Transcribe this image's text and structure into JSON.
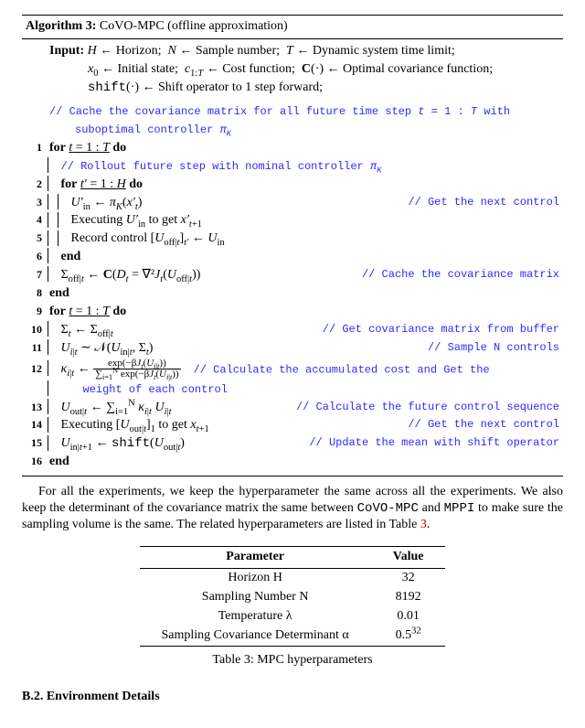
{
  "algo": {
    "heading": "Algorithm 3:",
    "name": "CoVO-MPC (offline approximation)",
    "input_label": "Input:",
    "input_l1": "H ← Horizon;  N ← Sample number;  T ← Dynamic system time limit;",
    "input_l2": "x₀ ← Initial state;  c₁:T ← Cost function;  C(·) ← Optimal covariance function;",
    "input_l3": "shift(·) ← Shift operator to 1 step forward;",
    "c_cache_a": "// Cache the covariance matrix for all future time step t = 1 : T with",
    "c_cache_b": "suboptimal controller πK",
    "for1": "for",
    "for1_cond": "t = 1 : T",
    "do": "do",
    "c_rollout": "// Rollout future step with nominal controller πK",
    "for2_cond": "t′ = 1 : H",
    "l3": "U′_in ← π_K(x′_t)",
    "c3": "// Get the next control",
    "l4": "Executing U′_in to get x′_{t+1}",
    "l5": "Record control [U_off|t]_{t′} ← U_in",
    "end": "end",
    "l7": "Σ_off|t ← C(D_t = ∇²J_t(U_off|t))",
    "c7": "// Cache the covariance matrix",
    "for3_cond": "t = 1 : T",
    "l10": "Σ_t ← Σ_off|t",
    "c10": "// Get covariance matrix from buffer",
    "l11": "U_{i|t} ∼ 𝓝(U_{in|t}, Σ_t)",
    "c11": "// Sample N controls",
    "l12a": "κ_{i|t} ← ",
    "frac_top": "exp(−βJ_t(U_{i|t}))",
    "frac_bot": "∑_{i=1}^{N} exp(−βJ_t(U_{i|t}))",
    "c12a": "// Calculate the accumulated cost and Get the",
    "c12b": "weight of each control",
    "l13": "U_{out|t} ← ∑_{i=1}^{N} κ_{i|t} U_{i|t}",
    "c13": "// Calculate the future control sequence",
    "l14": "Executing [U_{out|t}]₁ to get x_{t+1}",
    "c14": "// Get the next control",
    "l15": "U_{in|t+1} ← shift(U_{out|t})",
    "c15": "// Update the mean with shift operator"
  },
  "para1a": "For all the experiments, we keep the hyperparameter the same across all the experiments. We also keep the determinant of the covariance matrix the same between ",
  "para1b": " and ",
  "para1c": " to make sure the sampling volume is the same. The related hyperparameters are listed in Table ",
  "para1_ref": "3",
  "para1d": ".",
  "mono_a": "CoVO-MPC",
  "mono_b": "MPPI",
  "table": {
    "h1": "Parameter",
    "h2": "Value",
    "rows": [
      {
        "p": "Horizon H",
        "v": "32"
      },
      {
        "p": "Sampling Number N",
        "v": "8192"
      },
      {
        "p": "Temperature λ",
        "v": "0.01"
      },
      {
        "p": "Sampling Covariance Determinant α",
        "v": "0.5³²"
      }
    ],
    "caption": "Table 3: MPC hyperparameters"
  },
  "section": "B.2.  Environment Details",
  "chart_data": {
    "type": "table",
    "title": "MPC hyperparameters",
    "columns": [
      "Parameter",
      "Value"
    ],
    "rows": [
      [
        "Horizon H",
        32
      ],
      [
        "Sampling Number N",
        8192
      ],
      [
        "Temperature λ",
        0.01
      ],
      [
        "Sampling Covariance Determinant α",
        "0.5^32"
      ]
    ]
  }
}
